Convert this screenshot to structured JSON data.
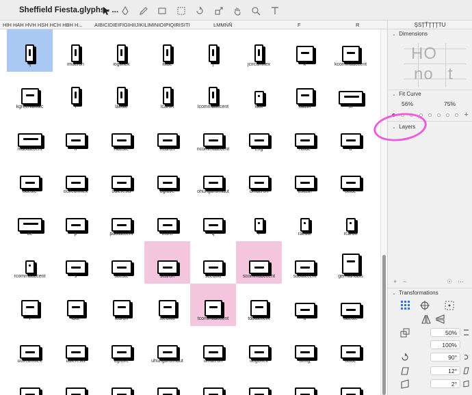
{
  "window": {
    "title": "Sheffield Fiesta.glyphs - ..."
  },
  "tabs": [
    {
      "label": "HIH HAH HVH HSH HCH HBH H..."
    },
    {
      "label": "AIBICIDIEIFIGIHIIJIKILIMINIOIPIQIRISITI..."
    },
    {
      "label": "ĿMMŃŇ"
    },
    {
      "label": "F"
    },
    {
      "label": "R"
    }
  ],
  "panel_header": "ȘSȚŤŢȚŢTU",
  "glyphs": [
    {
      "name": "ij",
      "state": "selected",
      "shape": "g-narrow"
    },
    {
      "name": "imacron",
      "state": "",
      "shape": "g-narrow"
    },
    {
      "name": "iogonek",
      "state": "",
      "shape": "g-narrow"
    },
    {
      "name": "itilde",
      "state": "",
      "shape": "g-narrow"
    },
    {
      "name": "j",
      "state": "",
      "shape": "g-narrow"
    },
    {
      "name": "jcircumflex",
      "state": "",
      "shape": "g-narrow"
    },
    {
      "name": "k",
      "state": "",
      "shape": "g-mid"
    },
    {
      "name": "kcommaaccent",
      "state": "",
      "shape": "g-mid"
    },
    {
      "name": "kgreenlandic",
      "state": "",
      "shape": "g-mid"
    },
    {
      "name": "l",
      "state": "",
      "shape": "g-narrow"
    },
    {
      "name": "lacute",
      "state": "",
      "shape": "g-narrow"
    },
    {
      "name": "lcaron",
      "state": "",
      "shape": "g-narrow"
    },
    {
      "name": "lcommaaccent",
      "state": "",
      "shape": "g-narrow"
    },
    {
      "name": "ldot",
      "state": "",
      "shape": "g-small"
    },
    {
      "name": "lslash",
      "state": "",
      "shape": "g-mid"
    },
    {
      "name": "m",
      "state": "",
      "shape": "g-wide2"
    },
    {
      "name": "mdotaccent",
      "state": "",
      "shape": "g-wide2"
    },
    {
      "name": "n",
      "state": "",
      "shape": "g-wide"
    },
    {
      "name": "nacute",
      "state": "",
      "shape": "g-wide"
    },
    {
      "name": "ncaron",
      "state": "",
      "shape": "g-wide"
    },
    {
      "name": "ncommaaccent",
      "state": "",
      "shape": "g-wide"
    },
    {
      "name": "eng",
      "state": "",
      "shape": "g-wide"
    },
    {
      "name": "ntilde",
      "state": "",
      "shape": "g-wide"
    },
    {
      "name": "o",
      "state": "",
      "shape": "g-wide"
    },
    {
      "name": "oacute",
      "state": "",
      "shape": "g-wide"
    },
    {
      "name": "ocircumflex",
      "state": "",
      "shape": "g-wide"
    },
    {
      "name": "odieresis",
      "state": "",
      "shape": "g-wide"
    },
    {
      "name": "ograve",
      "state": "",
      "shape": "g-wide"
    },
    {
      "name": "ohungarumlaut",
      "state": "",
      "shape": "g-wide"
    },
    {
      "name": "omacron",
      "state": "",
      "shape": "g-wide"
    },
    {
      "name": "oslash",
      "state": "",
      "shape": "g-wide"
    },
    {
      "name": "otilde",
      "state": "",
      "shape": "g-wide"
    },
    {
      "name": "oe",
      "state": "",
      "shape": "g-wide2"
    },
    {
      "name": "p",
      "state": "",
      "shape": "g-wide"
    },
    {
      "name": "pdotaccent",
      "state": "",
      "shape": "g-wide"
    },
    {
      "name": "thorn",
      "state": "",
      "shape": "g-wide"
    },
    {
      "name": "q",
      "state": "",
      "shape": "g-wide"
    },
    {
      "name": "r",
      "state": "",
      "shape": "g-small"
    },
    {
      "name": "racute",
      "state": "",
      "shape": "g-small"
    },
    {
      "name": "rcaron",
      "state": "",
      "shape": "g-small"
    },
    {
      "name": "rcommaaccent",
      "state": "",
      "shape": "g-small"
    },
    {
      "name": "s",
      "state": "",
      "shape": "g-wide"
    },
    {
      "name": "sacute",
      "state": "",
      "shape": "g-wide"
    },
    {
      "name": "scaron",
      "state": "marked",
      "shape": "g-wide"
    },
    {
      "name": "scedilla",
      "state": "",
      "shape": "g-wide"
    },
    {
      "name": "scommaaccent",
      "state": "marked",
      "shape": "g-wide"
    },
    {
      "name": "sdotaccent",
      "state": "",
      "shape": "g-wide"
    },
    {
      "name": "germandbls",
      "state": "",
      "shape": "g-tall"
    },
    {
      "name": "t",
      "state": "",
      "shape": "g-mid"
    },
    {
      "name": "tbar",
      "state": "",
      "shape": "g-mid"
    },
    {
      "name": "tcaron",
      "state": "",
      "shape": "g-mid"
    },
    {
      "name": "tcedilla",
      "state": "",
      "shape": "g-mid"
    },
    {
      "name": "tcommaaccent",
      "state": "marked",
      "shape": "g-mid"
    },
    {
      "name": "tdotaccent",
      "state": "",
      "shape": "g-mid"
    },
    {
      "name": "u",
      "state": "",
      "shape": "g-wide"
    },
    {
      "name": "uacute",
      "state": "",
      "shape": "g-wide"
    },
    {
      "name": "ucircumflex",
      "state": "",
      "shape": "g-wide"
    },
    {
      "name": "udieresis",
      "state": "",
      "shape": "g-wide"
    },
    {
      "name": "ugrave",
      "state": "",
      "shape": "g-wide"
    },
    {
      "name": "uhungarumlaut",
      "state": "",
      "shape": "g-wide"
    },
    {
      "name": "umacron",
      "state": "",
      "shape": "g-wide"
    },
    {
      "name": "uogonek",
      "state": "",
      "shape": "g-wide"
    },
    {
      "name": "uring",
      "state": "",
      "shape": "g-wide"
    },
    {
      "name": "utilde",
      "state": "",
      "shape": "g-wide"
    },
    {
      "name": "",
      "state": "",
      "shape": "g-wide"
    },
    {
      "name": "",
      "state": "",
      "shape": "g-wide"
    },
    {
      "name": "",
      "state": "",
      "shape": "g-wide"
    },
    {
      "name": "",
      "state": "",
      "shape": "g-wide"
    },
    {
      "name": "",
      "state": "",
      "shape": "g-wide"
    },
    {
      "name": "",
      "state": "",
      "shape": "g-wide"
    },
    {
      "name": "",
      "state": "",
      "shape": "g-wide"
    },
    {
      "name": "",
      "state": "",
      "shape": "g-wide"
    }
  ],
  "panel": {
    "dimensions": {
      "label": "Dimensions",
      "sample_top": "HO",
      "sample_bottom_left": "no",
      "sample_bottom_right": "t"
    },
    "fit_curve": {
      "label": "Fit Curve",
      "left_value": "56%",
      "right_value": "75%"
    },
    "layers": {
      "label": "Layers"
    },
    "transformations": {
      "label": "Transformations",
      "scale_x": "50%",
      "scale_y": "100%",
      "rotate": "90°",
      "slant": "12°",
      "skew": "2°"
    }
  },
  "colors": {
    "selection": "#a9c9f2",
    "mark_pink": "#f4c6dd",
    "annotation_ring": "#f05ae0"
  }
}
